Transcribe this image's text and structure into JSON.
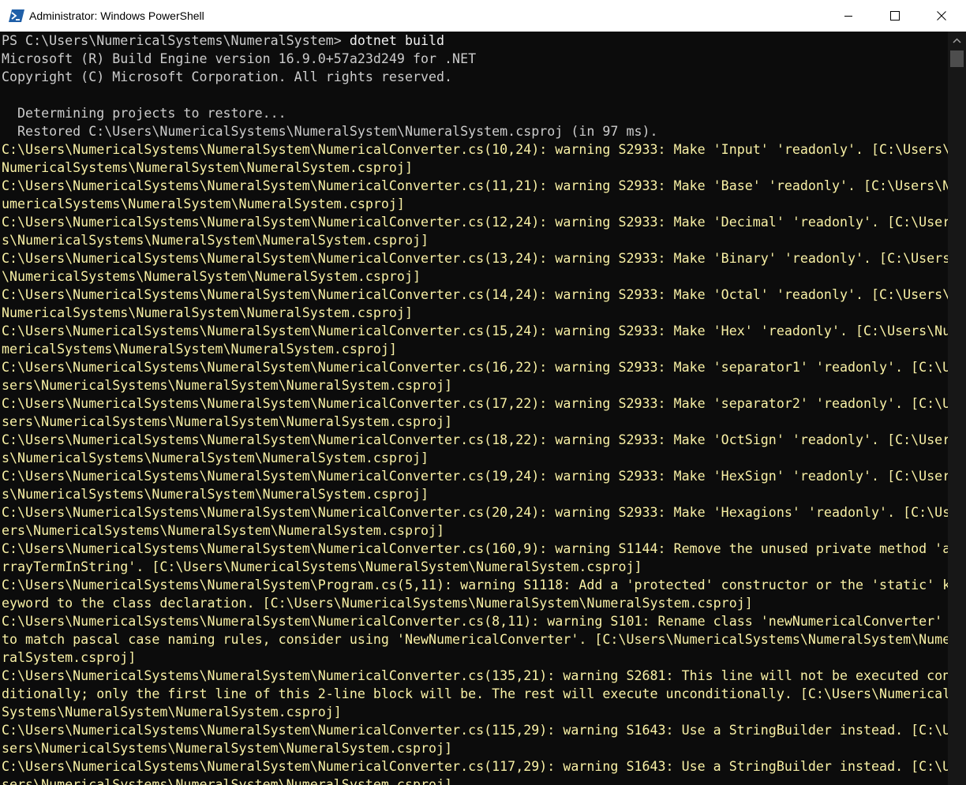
{
  "window": {
    "title": "Administrator: Windows PowerShell",
    "icons": {
      "app": "powershell-icon",
      "minimize": "minimize-icon",
      "maximize": "maximize-icon",
      "close": "close-icon"
    }
  },
  "colors": {
    "background": "#0c0c0c",
    "default_text": "#cccccc",
    "warning_text": "#f9f1a5",
    "command_text": "#f2f2f2"
  },
  "console": {
    "prompt": "PS C:\\Users\\NumericalSystems\\NumeralSystem> ",
    "command": "dotnet build",
    "output": [
      {
        "style": "gray",
        "text": "Microsoft (R) Build Engine version 16.9.0+57a23d249 for .NET"
      },
      {
        "style": "gray",
        "text": "Copyright (C) Microsoft Corporation. All rights reserved."
      },
      {
        "style": "gray",
        "text": ""
      },
      {
        "style": "gray",
        "text": "  Determining projects to restore..."
      },
      {
        "style": "gray",
        "text": "  Restored C:\\Users\\NumericalSystems\\NumeralSystem\\NumeralSystem.csproj (in 97 ms)."
      },
      {
        "style": "yellow",
        "text": "C:\\Users\\NumericalSystems\\NumeralSystem\\NumericalConverter.cs(10,24): warning S2933: Make 'Input' 'readonly'. [C:\\Users\\"
      },
      {
        "style": "yellow",
        "text": "NumericalSystems\\NumeralSystem\\NumeralSystem.csproj]"
      },
      {
        "style": "yellow",
        "text": "C:\\Users\\NumericalSystems\\NumeralSystem\\NumericalConverter.cs(11,21): warning S2933: Make 'Base' 'readonly'. [C:\\Users\\N"
      },
      {
        "style": "yellow",
        "text": "umericalSystems\\NumeralSystem\\NumeralSystem.csproj]"
      },
      {
        "style": "yellow",
        "text": "C:\\Users\\NumericalSystems\\NumeralSystem\\NumericalConverter.cs(12,24): warning S2933: Make 'Decimal' 'readonly'. [C:\\User"
      },
      {
        "style": "yellow",
        "text": "s\\NumericalSystems\\NumeralSystem\\NumeralSystem.csproj]"
      },
      {
        "style": "yellow",
        "text": "C:\\Users\\NumericalSystems\\NumeralSystem\\NumericalConverter.cs(13,24): warning S2933: Make 'Binary' 'readonly'. [C:\\Users"
      },
      {
        "style": "yellow",
        "text": "\\NumericalSystems\\NumeralSystem\\NumeralSystem.csproj]"
      },
      {
        "style": "yellow",
        "text": "C:\\Users\\NumericalSystems\\NumeralSystem\\NumericalConverter.cs(14,24): warning S2933: Make 'Octal' 'readonly'. [C:\\Users\\"
      },
      {
        "style": "yellow",
        "text": "NumericalSystems\\NumeralSystem\\NumeralSystem.csproj]"
      },
      {
        "style": "yellow",
        "text": "C:\\Users\\NumericalSystems\\NumeralSystem\\NumericalConverter.cs(15,24): warning S2933: Make 'Hex' 'readonly'. [C:\\Users\\Nu"
      },
      {
        "style": "yellow",
        "text": "mericalSystems\\NumeralSystem\\NumeralSystem.csproj]"
      },
      {
        "style": "yellow",
        "text": "C:\\Users\\NumericalSystems\\NumeralSystem\\NumericalConverter.cs(16,22): warning S2933: Make 'separator1' 'readonly'. [C:\\U"
      },
      {
        "style": "yellow",
        "text": "sers\\NumericalSystems\\NumeralSystem\\NumeralSystem.csproj]"
      },
      {
        "style": "yellow",
        "text": "C:\\Users\\NumericalSystems\\NumeralSystem\\NumericalConverter.cs(17,22): warning S2933: Make 'separator2' 'readonly'. [C:\\U"
      },
      {
        "style": "yellow",
        "text": "sers\\NumericalSystems\\NumeralSystem\\NumeralSystem.csproj]"
      },
      {
        "style": "yellow",
        "text": "C:\\Users\\NumericalSystems\\NumeralSystem\\NumericalConverter.cs(18,22): warning S2933: Make 'OctSign' 'readonly'. [C:\\User"
      },
      {
        "style": "yellow",
        "text": "s\\NumericalSystems\\NumeralSystem\\NumeralSystem.csproj]"
      },
      {
        "style": "yellow",
        "text": "C:\\Users\\NumericalSystems\\NumeralSystem\\NumericalConverter.cs(19,24): warning S2933: Make 'HexSign' 'readonly'. [C:\\User"
      },
      {
        "style": "yellow",
        "text": "s\\NumericalSystems\\NumeralSystem\\NumeralSystem.csproj]"
      },
      {
        "style": "yellow",
        "text": "C:\\Users\\NumericalSystems\\NumeralSystem\\NumericalConverter.cs(20,24): warning S2933: Make 'Hexagions' 'readonly'. [C:\\Us"
      },
      {
        "style": "yellow",
        "text": "ers\\NumericalSystems\\NumeralSystem\\NumeralSystem.csproj]"
      },
      {
        "style": "yellow",
        "text": "C:\\Users\\NumericalSystems\\NumeralSystem\\NumericalConverter.cs(160,9): warning S1144: Remove the unused private method 'a"
      },
      {
        "style": "yellow",
        "text": "rrayTermInString'. [C:\\Users\\NumericalSystems\\NumeralSystem\\NumeralSystem.csproj]"
      },
      {
        "style": "yellow",
        "text": "C:\\Users\\NumericalSystems\\NumeralSystem\\Program.cs(5,11): warning S1118: Add a 'protected' constructor or the 'static' k"
      },
      {
        "style": "yellow",
        "text": "eyword to the class declaration. [C:\\Users\\NumericalSystems\\NumeralSystem\\NumeralSystem.csproj]"
      },
      {
        "style": "yellow",
        "text": "C:\\Users\\NumericalSystems\\NumeralSystem\\NumericalConverter.cs(8,11): warning S101: Rename class 'newNumericalConverter'"
      },
      {
        "style": "yellow",
        "text": "to match pascal case naming rules, consider using 'NewNumericalConverter'. [C:\\Users\\NumericalSystems\\NumeralSystem\\Nume"
      },
      {
        "style": "yellow",
        "text": "ralSystem.csproj]"
      },
      {
        "style": "yellow",
        "text": "C:\\Users\\NumericalSystems\\NumeralSystem\\NumericalConverter.cs(135,21): warning S2681: This line will not be executed con"
      },
      {
        "style": "yellow",
        "text": "ditionally; only the first line of this 2-line block will be. The rest will execute unconditionally. [C:\\Users\\Numerical"
      },
      {
        "style": "yellow",
        "text": "Systems\\NumeralSystem\\NumeralSystem.csproj]"
      },
      {
        "style": "yellow",
        "text": "C:\\Users\\NumericalSystems\\NumeralSystem\\NumericalConverter.cs(115,29): warning S1643: Use a StringBuilder instead. [C:\\U"
      },
      {
        "style": "yellow",
        "text": "sers\\NumericalSystems\\NumeralSystem\\NumeralSystem.csproj]"
      },
      {
        "style": "yellow",
        "text": "C:\\Users\\NumericalSystems\\NumeralSystem\\NumericalConverter.cs(117,29): warning S1643: Use a StringBuilder instead. [C:\\U"
      },
      {
        "style": "yellow",
        "text": "sers\\NumericalSystems\\NumeralSystem\\NumeralSystem.csproj]"
      }
    ]
  }
}
